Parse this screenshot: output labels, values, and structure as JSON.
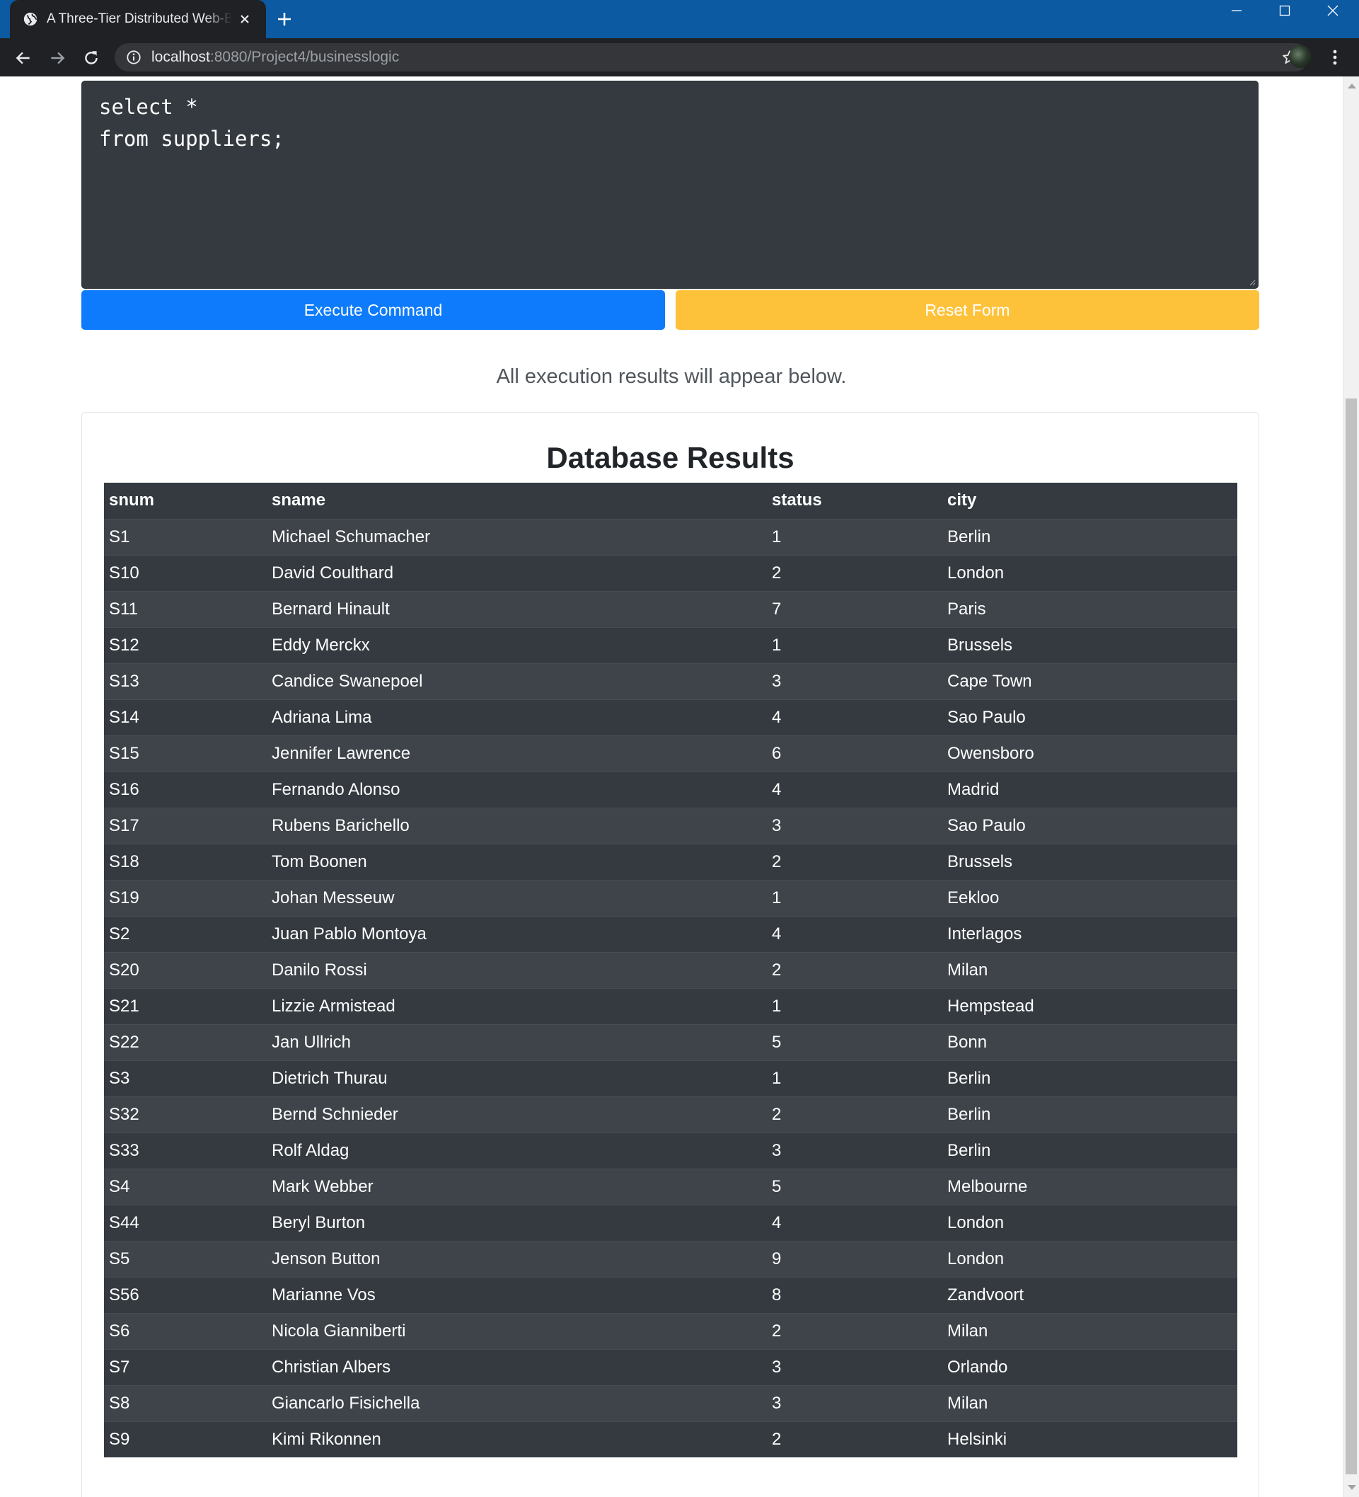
{
  "browser": {
    "tab_title": "A Three-Tier Distributed Web-Based Application",
    "url_host": "localhost",
    "url_path": ":8080/Project4/businesslogic"
  },
  "editor": {
    "command_text": "select *\nfrom suppliers;"
  },
  "buttons": {
    "execute_label": "Execute Command",
    "reset_label": "Reset Form"
  },
  "lead_text": "All execution results will appear below.",
  "results": {
    "title": "Database Results",
    "columns": [
      "snum",
      "sname",
      "status",
      "city"
    ],
    "rows": [
      [
        "S1",
        "Michael Schumacher",
        "1",
        "Berlin"
      ],
      [
        "S10",
        "David Coulthard",
        "2",
        "London"
      ],
      [
        "S11",
        "Bernard Hinault",
        "7",
        "Paris"
      ],
      [
        "S12",
        "Eddy Merckx",
        "1",
        "Brussels"
      ],
      [
        "S13",
        "Candice Swanepoel",
        "3",
        "Cape Town"
      ],
      [
        "S14",
        "Adriana Lima",
        "4",
        "Sao Paulo"
      ],
      [
        "S15",
        "Jennifer Lawrence",
        "6",
        "Owensboro"
      ],
      [
        "S16",
        "Fernando Alonso",
        "4",
        "Madrid"
      ],
      [
        "S17",
        "Rubens Barichello",
        "3",
        "Sao Paulo"
      ],
      [
        "S18",
        "Tom Boonen",
        "2",
        "Brussels"
      ],
      [
        "S19",
        "Johan Messeuw",
        "1",
        "Eekloo"
      ],
      [
        "S2",
        "Juan Pablo Montoya",
        "4",
        "Interlagos"
      ],
      [
        "S20",
        "Danilo Rossi",
        "2",
        "Milan"
      ],
      [
        "S21",
        "Lizzie Armistead",
        "1",
        "Hempstead"
      ],
      [
        "S22",
        "Jan Ullrich",
        "5",
        "Bonn"
      ],
      [
        "S3",
        "Dietrich Thurau",
        "1",
        "Berlin"
      ],
      [
        "S32",
        "Bernd Schnieder",
        "2",
        "Berlin"
      ],
      [
        "S33",
        "Rolf Aldag",
        "3",
        "Berlin"
      ],
      [
        "S4",
        "Mark Webber",
        "5",
        "Melbourne"
      ],
      [
        "S44",
        "Beryl Burton",
        "4",
        "London"
      ],
      [
        "S5",
        "Jenson Button",
        "9",
        "London"
      ],
      [
        "S56",
        "Marianne Vos",
        "8",
        "Zandvoort"
      ],
      [
        "S6",
        "Nicola Gianniberti",
        "2",
        "Milan"
      ],
      [
        "S7",
        "Christian Albers",
        "3",
        "Orlando"
      ],
      [
        "S8",
        "Giancarlo Fisichella",
        "3",
        "Milan"
      ],
      [
        "S9",
        "Kimi Rikonnen",
        "2",
        "Helsinki"
      ]
    ]
  },
  "colors": {
    "tabstrip": "#0b5aa2",
    "execute_button": "#0d7bfb",
    "reset_button": "#fec23a",
    "editor_background": "#343a40",
    "table_dark": "#343a40",
    "table_stripe": "#3e444a"
  },
  "icons": {
    "tab_favicon": "globe-icon",
    "tab_close": "close-icon",
    "new_tab": "plus-icon",
    "back": "arrow-left-icon",
    "forward": "arrow-right-icon",
    "reload": "reload-icon",
    "site_info": "info-icon",
    "bookmark": "star-icon",
    "profile": "avatar",
    "menu": "kebab-menu-icon"
  }
}
